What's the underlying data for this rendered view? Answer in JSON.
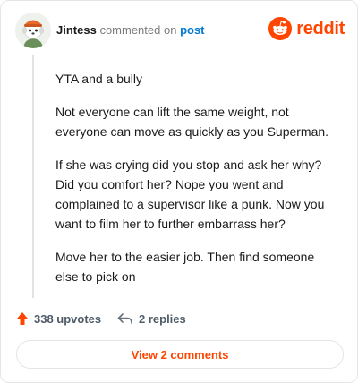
{
  "comment": {
    "author": "Jintess",
    "action_text": "commented on",
    "link_text": "post",
    "paragraphs": [
      "YTA and a bully",
      "Not everyone can lift the same weight, not everyone can move as quickly as you Superman.",
      "If she was crying did you stop and ask her why? Did you comfort her? Nope you went and complained to a supervisor like a punk. Now you want to film her to further embarrass her?",
      "Move her to the easier job. Then find someone else to pick on"
    ]
  },
  "brand": {
    "wordmark": "reddit",
    "icon": "reddit-snoo-icon",
    "color": "#ff4500"
  },
  "actions": {
    "upvotes_label": "338 upvotes",
    "upvote_icon": "upvote-arrow-icon",
    "replies_label": "2 replies",
    "reply_icon": "reply-arrow-icon"
  },
  "footer": {
    "view_comments_label": "View 2 comments"
  },
  "colors": {
    "accent": "#ff4500",
    "link": "#0079d3",
    "muted": "#7c7c7c"
  }
}
